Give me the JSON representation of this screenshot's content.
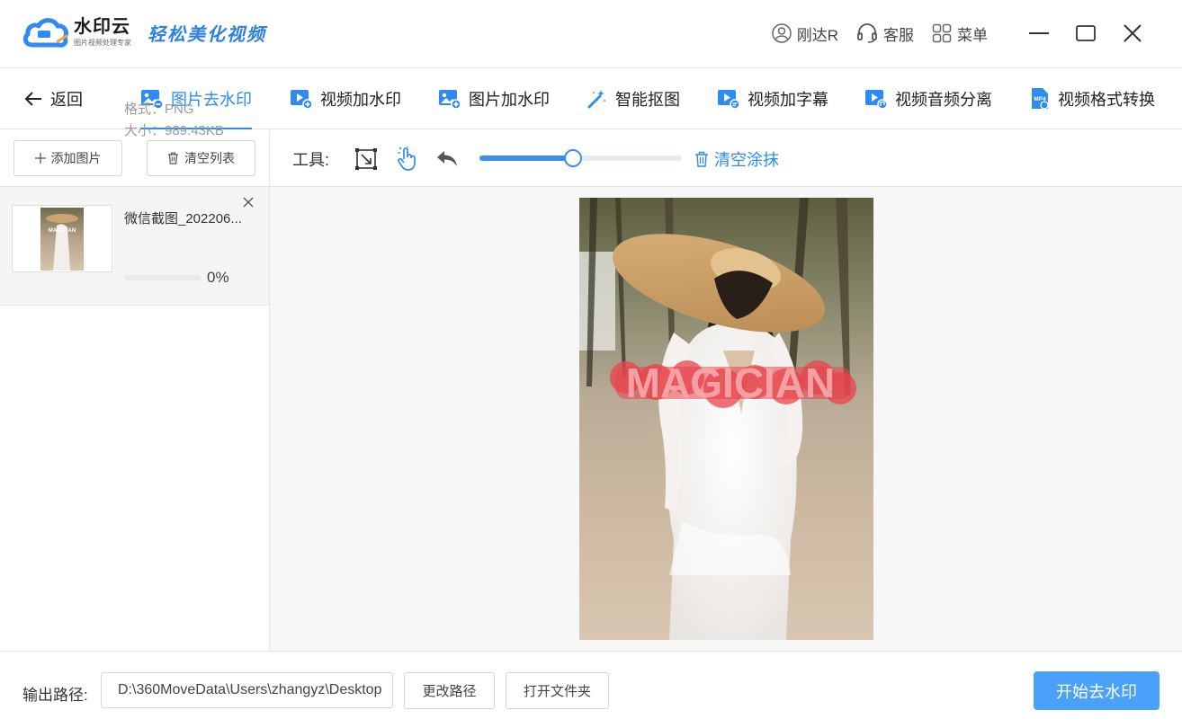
{
  "app": {
    "name": "水印云",
    "subtitle": "图片视频处理专家",
    "slogan": "轻松美化视频"
  },
  "titlebar": {
    "user": "刚达R",
    "service": "客服",
    "menu": "菜单"
  },
  "nav": {
    "back": "返回",
    "tabs": [
      {
        "label": "图片去水印",
        "icon": "image-remove-icon",
        "active": true
      },
      {
        "label": "视频加水印",
        "icon": "video-add-icon",
        "active": false
      },
      {
        "label": "图片加水印",
        "icon": "image-add-icon",
        "active": false
      },
      {
        "label": "智能抠图",
        "icon": "magic-wand-icon",
        "active": false
      },
      {
        "label": "视频加字幕",
        "icon": "video-subtitle-icon",
        "active": false
      },
      {
        "label": "视频音频分离",
        "icon": "video-audio-icon",
        "active": false
      },
      {
        "label": "视频格式转换",
        "icon": "mp4-icon",
        "active": false
      }
    ]
  },
  "leftpanel": {
    "add_button": "添加图片",
    "clear_button": "清空列表",
    "files": [
      {
        "name": "微信截图_202206...",
        "format": "格式：PNG",
        "size": "大小：989.43KB",
        "progress_percent": 0,
        "progress_text": "0%"
      }
    ]
  },
  "toolbar": {
    "label": "工具:",
    "brush_size_percent": 46,
    "clear_paint": "清空涂抹"
  },
  "canvas": {
    "watermark_text": "MAGICIAN"
  },
  "bottombar": {
    "output_label": "输出路径:",
    "output_path": "D:\\360MoveData\\Users\\zhangyz\\Desktop",
    "change_path": "更改路径",
    "open_folder": "打开文件夹",
    "start": "开始去水印"
  },
  "colors": {
    "accent": "#2f8bf0",
    "start_button": "#4aa1fb",
    "watermark_mask": "#e8434b"
  }
}
